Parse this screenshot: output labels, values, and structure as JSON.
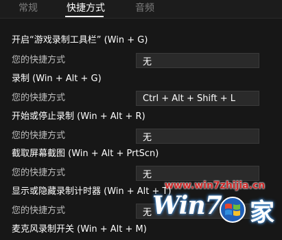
{
  "tabs": [
    {
      "label": "常规",
      "active": false
    },
    {
      "label": "快捷方式",
      "active": true
    },
    {
      "label": "音频",
      "active": false
    }
  ],
  "shortcut_field_label": "您的快捷方式",
  "shortcuts": [
    {
      "title": "开启“游戏录制工具栏” (Win + G)",
      "value": "无"
    },
    {
      "title": "录制 (Win + Alt + G)",
      "value": "Ctrl + Alt + Shift + L"
    },
    {
      "title": "开始或停止录制 (Win + Alt + R)",
      "value": "无"
    },
    {
      "title": "截取屏幕截图 (Win + Alt + PrtScn)",
      "value": "无"
    },
    {
      "title": "显示或隐藏录制计时器 (Win + Alt + T)",
      "value": "无"
    },
    {
      "title": "麦克风录制开关 (Win + Alt + M)",
      "value": ""
    }
  ],
  "watermark": {
    "url": "www.win7zhijia.cn",
    "logo": "Win7",
    "suffix": "家"
  },
  "colors": {
    "background": "#171717",
    "field_background": "#2a2a2a",
    "field_border": "#3a3a3a",
    "label": "#bdbdbd",
    "watermark_red": "#cc2a2a"
  }
}
